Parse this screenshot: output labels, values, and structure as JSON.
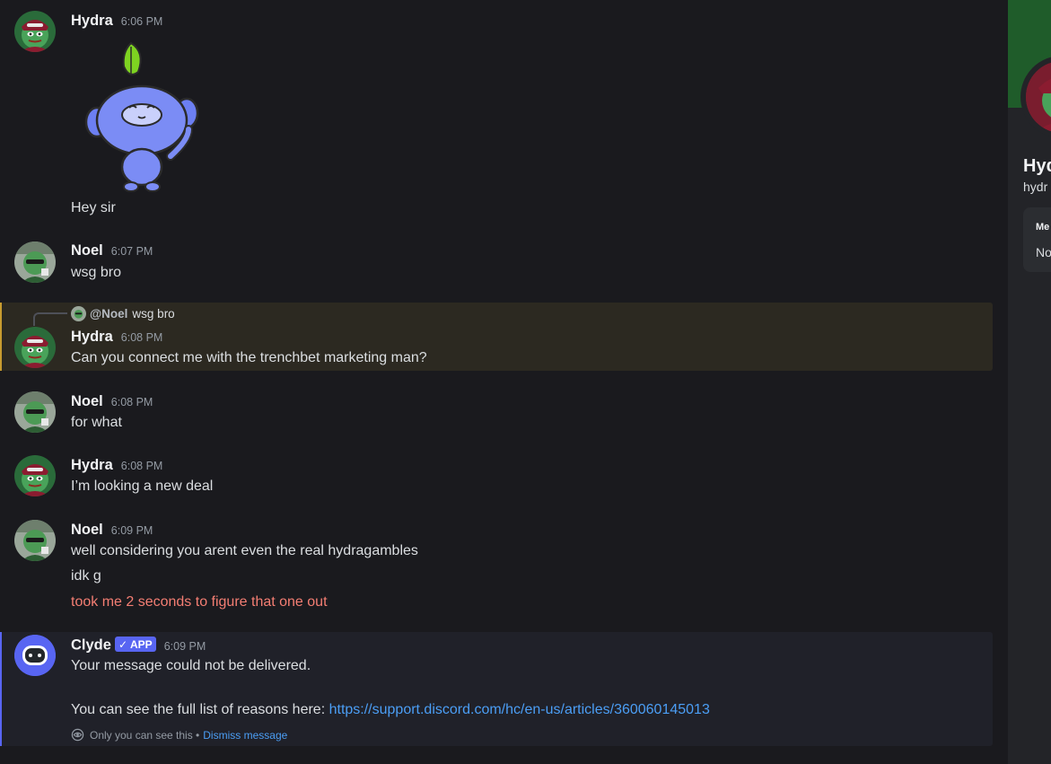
{
  "messages": [
    {
      "author": "Hydra",
      "time": "6:06 PM",
      "text": "Hey sir"
    },
    {
      "author": "Noel",
      "time": "6:07 PM",
      "text": "wsg bro"
    },
    {
      "reply_to": {
        "mention": "@Noel",
        "text": "wsg bro"
      },
      "author": "Hydra",
      "time": "6:08 PM",
      "text": "Can you connect me with the trenchbet marketing man?"
    },
    {
      "author": "Noel",
      "time": "6:08 PM",
      "text": "for what"
    },
    {
      "author": "Hydra",
      "time": "6:08 PM",
      "text": "I’m looking a new deal"
    },
    {
      "author": "Noel",
      "time": "6:09 PM",
      "lines": [
        "well considering you arent even the real hydragambles",
        "idk g",
        "took me 2 seconds to figure that one out"
      ]
    },
    {
      "author": "Clyde",
      "badge": "APP",
      "time": "6:09 PM",
      "line1": "Your message could not be delivered.",
      "line2_prefix": "You can see the full list of reasons here: ",
      "line2_link": "https://support.discord.com/hc/en-us/articles/360060145013",
      "note": "Only you can see this •",
      "dismiss": "Dismiss message"
    }
  ],
  "sidebar": {
    "display_name": "Hyd",
    "username": "hydr",
    "card_title": "Me",
    "card_note": "No"
  },
  "colors": {
    "background": "#1a1a1e",
    "reply_highlight": "#2c2921",
    "clyde_highlight": "#202129",
    "blurple": "#5865f2",
    "link": "#4b9ef5",
    "red_text": "#f47e73"
  }
}
